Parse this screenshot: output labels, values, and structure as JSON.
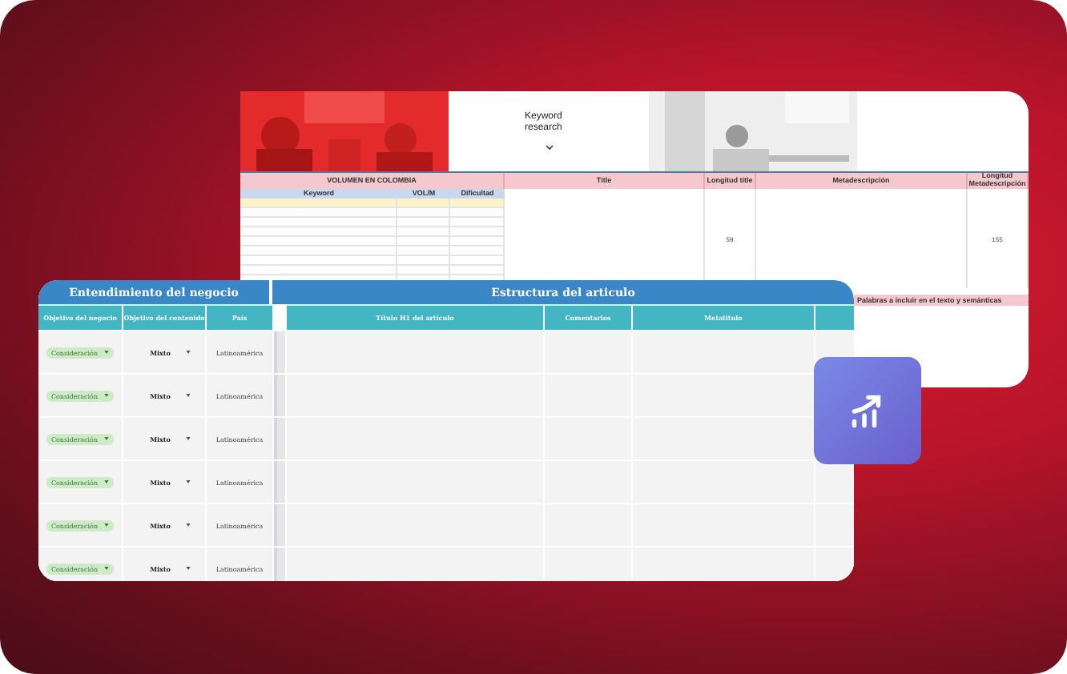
{
  "back_sheet": {
    "title": "Keyword research",
    "headers": [
      {
        "text": "VOLUMEN EN COLOMBIA"
      },
      {
        "text": "Title"
      },
      {
        "text": "Longitud title"
      },
      {
        "text": "Metadescripción"
      },
      {
        "text": "Longitud Metadescripción"
      }
    ],
    "subheaders": [
      "Keyword",
      "VOL/M",
      "Dificultad"
    ],
    "title_length": "59",
    "meta_length": "155",
    "note": "Palabras a incluir en el texto y semánticas"
  },
  "front_sheet": {
    "groups": [
      "Entendimiento del negocio",
      "Estructura del articulo"
    ],
    "columns": [
      "Objetivo del negocio",
      "Objetivo del contenido",
      "País",
      "Título H1 del artículo",
      "Comentarios",
      "Metatitulo"
    ],
    "rows": [
      {
        "goal": "Consideración",
        "content": "Mixto",
        "country": "Latinoamérica"
      },
      {
        "goal": "Consideración",
        "content": "Mixto",
        "country": "Latinoamérica"
      },
      {
        "goal": "Consideración",
        "content": "Mixto",
        "country": "Latinoamérica"
      },
      {
        "goal": "Consideración",
        "content": "Mixto",
        "country": "Latinoamérica"
      },
      {
        "goal": "Consideración",
        "content": "Mixto",
        "country": "Latinoamérica"
      },
      {
        "goal": "Consideración",
        "content": "Mixto",
        "country": "Latinoamérica"
      }
    ]
  }
}
